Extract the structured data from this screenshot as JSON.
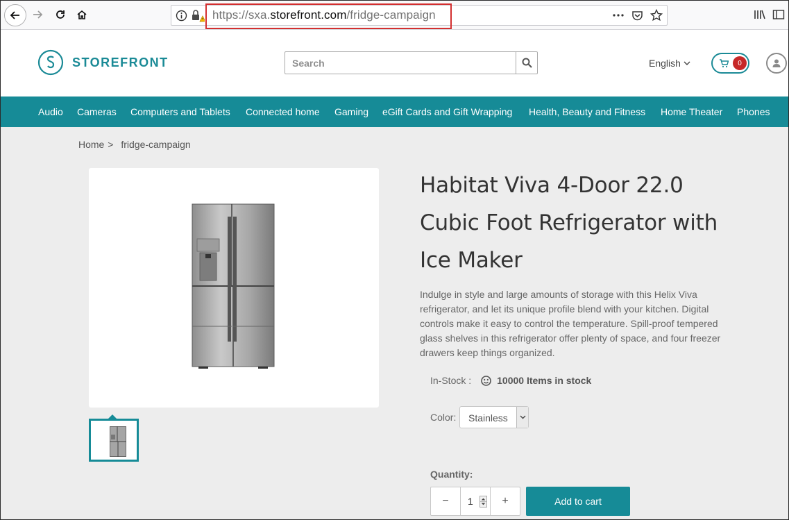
{
  "browser": {
    "url_prefix": "https://sxa.",
    "url_domain": "storefront.com",
    "url_path": "/fridge-campaign"
  },
  "header": {
    "logo_text": "STOREFRONT",
    "search_placeholder": "Search",
    "language": "English",
    "cart_count": "0"
  },
  "nav": {
    "items": [
      "Audio",
      "Cameras",
      "Computers and Tablets",
      "Connected home",
      "Gaming",
      "eGift Cards and Gift Wrapping",
      "Health, Beauty and Fitness",
      "Home Theater",
      "Phones"
    ]
  },
  "breadcrumb": {
    "home": "Home",
    "separator": ">",
    "current": "fridge-campaign"
  },
  "product": {
    "title": "Habitat Viva 4-Door 22.0 Cubic Foot Refrigerator with Ice Maker",
    "description": "Indulge in style and large amounts of storage with this Helix Viva refrigerator, and let its unique profile blend with your kitchen. Digital controls make it easy to control the temperature. Spill-proof tempered glass shelves in this refrigerator offer plenty of space, and four freezer drawers keep things organized.",
    "stock_label": "In-Stock :",
    "stock_value": "10000 Items in stock",
    "color_label": "Color:",
    "color_value": "Stainless",
    "quantity_label": "Quantity:",
    "quantity_value": "1",
    "minus": "−",
    "plus": "+",
    "add_to_cart": "Add to cart"
  },
  "colors": {
    "accent": "#168b97",
    "badge": "#c62828",
    "highlight": "#d32f2f"
  }
}
